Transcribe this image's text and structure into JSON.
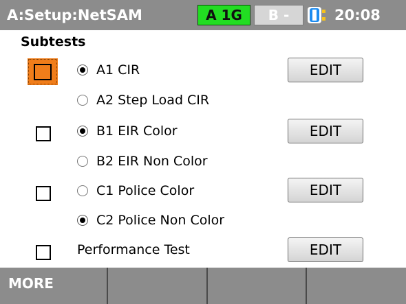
{
  "header": {
    "title": "A:Setup:NetSAM",
    "port_a": "A 1G",
    "port_b": "B -",
    "battery_icon": "battery-icon",
    "time": "20:08",
    "colors": {
      "bar": "#8c8c8c",
      "port_a_active": "#22dd22",
      "focus": "#f07d1a"
    }
  },
  "section_title": "Subtests",
  "groups": [
    {
      "checked": false,
      "focused": true,
      "options": [
        {
          "label": "A1 CIR",
          "selected": true
        },
        {
          "label": "A2 Step Load CIR",
          "selected": false
        }
      ],
      "edit_label": "EDIT"
    },
    {
      "checked": false,
      "focused": false,
      "options": [
        {
          "label": "B1 EIR Color",
          "selected": true
        },
        {
          "label": "B2 EIR Non Color",
          "selected": false
        }
      ],
      "edit_label": "EDIT"
    },
    {
      "checked": false,
      "focused": false,
      "options": [
        {
          "label": "C1 Police Color",
          "selected": false
        },
        {
          "label": "C2 Police Non Color",
          "selected": true
        }
      ],
      "edit_label": "EDIT"
    },
    {
      "checked": false,
      "focused": false,
      "label": "Performance Test",
      "edit_label": "EDIT"
    }
  ],
  "footer": {
    "keys": [
      "MORE",
      "",
      "",
      ""
    ]
  }
}
